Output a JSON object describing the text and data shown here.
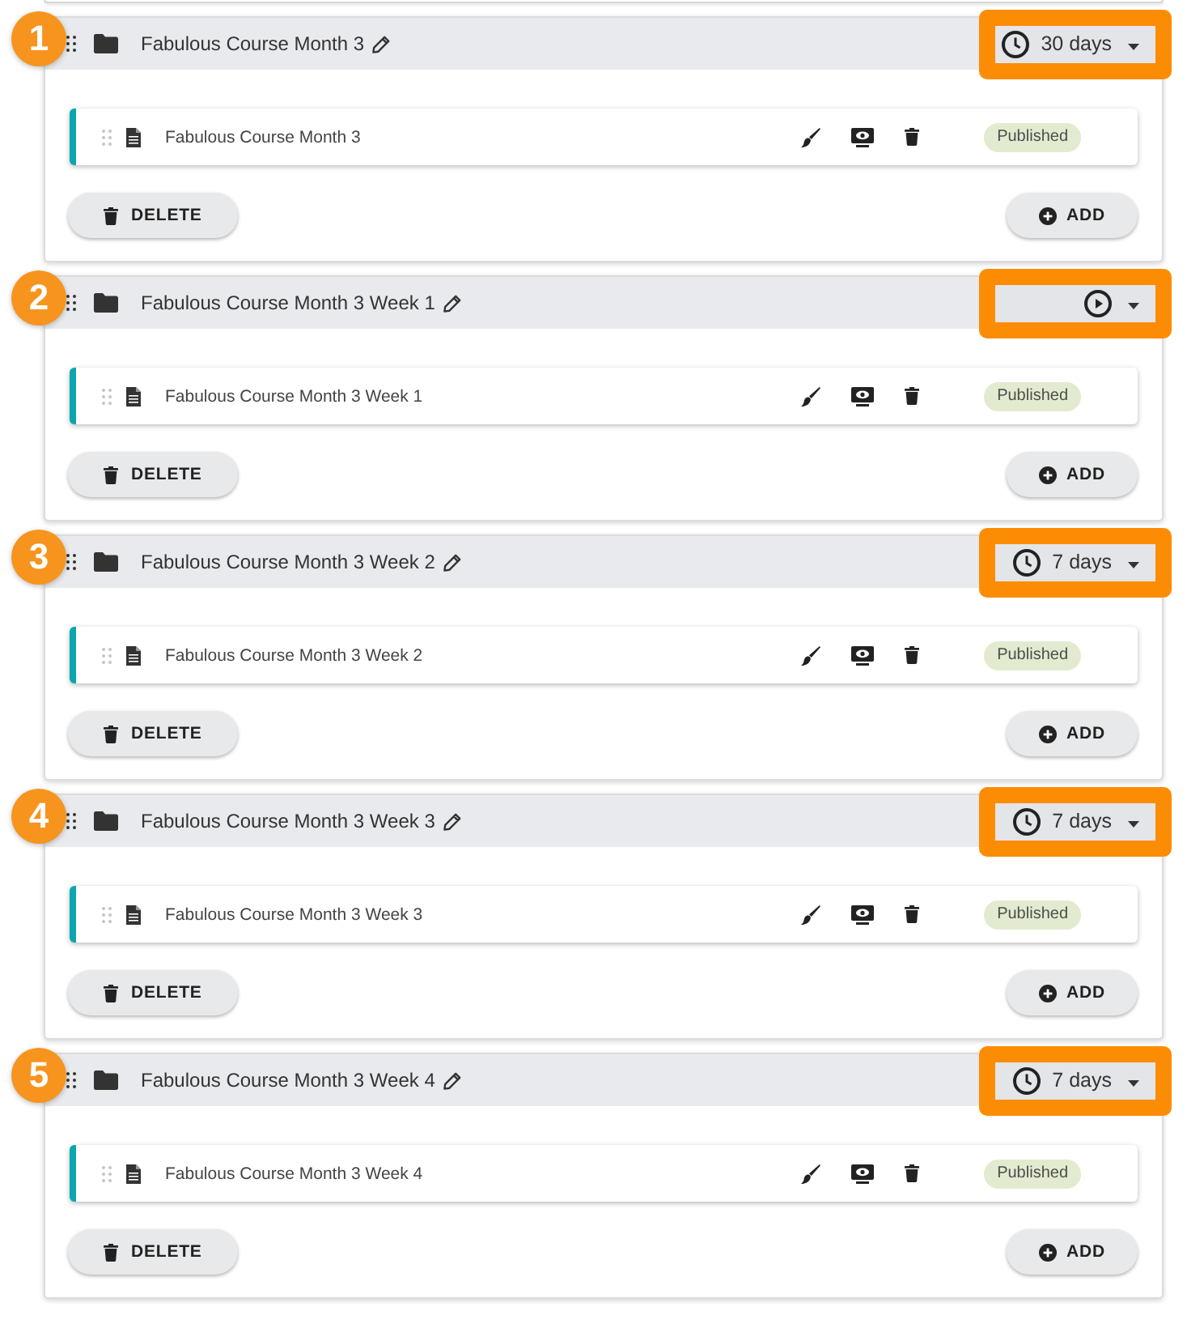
{
  "modules": [
    {
      "callout": "1",
      "title": "Fabulous Course Month 3",
      "duration": {
        "kind": "timed",
        "label": "30 days",
        "highlighted": true
      },
      "lessons": [
        {
          "title": "Fabulous Course Month 3",
          "status": "Published"
        }
      ],
      "actions": {
        "delete": "DELETE",
        "add": "ADD"
      }
    },
    {
      "callout": "2",
      "title": "Fabulous Course Month 3 Week 1",
      "duration": {
        "kind": "play",
        "highlighted": true
      },
      "lessons": [
        {
          "title": "Fabulous Course Month 3 Week 1",
          "status": "Published"
        }
      ],
      "actions": {
        "delete": "DELETE",
        "add": "ADD"
      }
    },
    {
      "callout": "3",
      "title": "Fabulous Course Month 3 Week 2",
      "duration": {
        "kind": "timed",
        "label": "7 days",
        "highlighted": true
      },
      "lessons": [
        {
          "title": "Fabulous Course Month 3 Week 2",
          "status": "Published"
        }
      ],
      "actions": {
        "delete": "DELETE",
        "add": "ADD"
      }
    },
    {
      "callout": "4",
      "title": "Fabulous Course Month 3 Week 3",
      "duration": {
        "kind": "timed",
        "label": "7 days",
        "highlighted": true
      },
      "lessons": [
        {
          "title": "Fabulous Course Month 3 Week 3",
          "status": "Published"
        }
      ],
      "actions": {
        "delete": "DELETE",
        "add": "ADD"
      }
    },
    {
      "callout": "5",
      "title": "Fabulous Course Month 3 Week 4",
      "duration": {
        "kind": "timed",
        "label": "7 days",
        "highlighted": true
      },
      "lessons": [
        {
          "title": "Fabulous Course Month 3 Week 4",
          "status": "Published"
        }
      ],
      "actions": {
        "delete": "DELETE",
        "add": "ADD"
      }
    }
  ]
}
